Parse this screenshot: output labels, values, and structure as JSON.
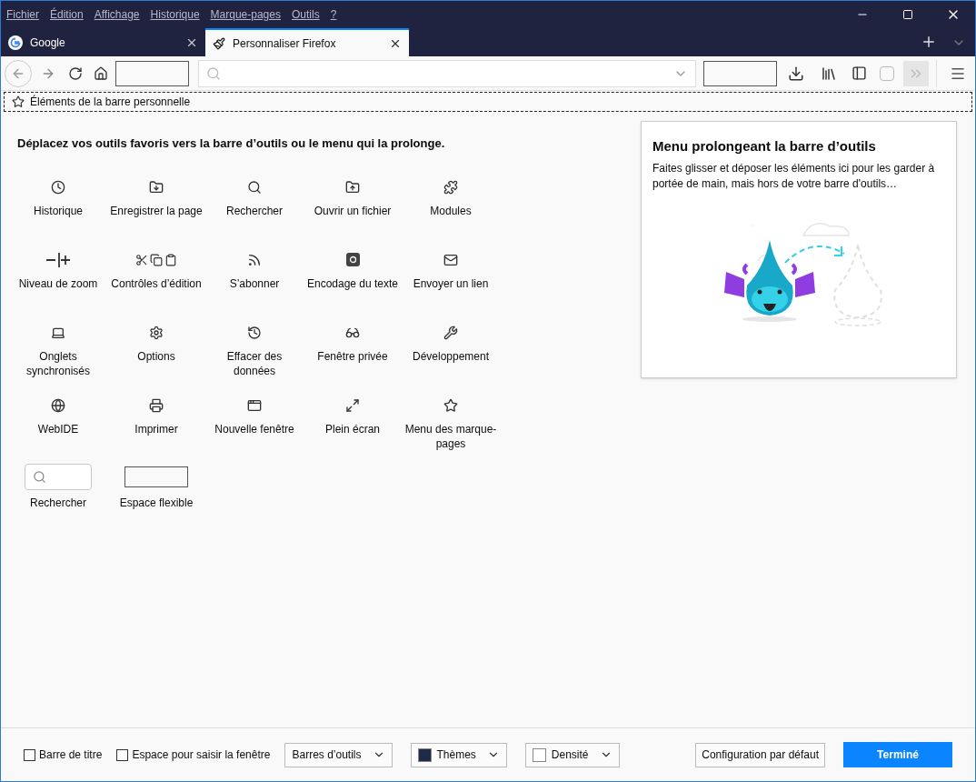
{
  "menu": [
    "Fichier",
    "Édition",
    "Affichage",
    "Historique",
    "Marque-pages",
    "Outils",
    "?"
  ],
  "tabs": [
    {
      "label": "Google",
      "selected": false
    },
    {
      "label": "Personnaliser Firefox",
      "selected": true
    }
  ],
  "bookmarks_bar": {
    "label": "Éléments de la barre personnelle"
  },
  "heading": "Déplacez vos outils favoris vers la barre d’outils ou le menu qui la prolonge.",
  "palette": [
    {
      "kind": "icon",
      "label": "Historique"
    },
    {
      "kind": "icon",
      "label": "Enregistrer la page"
    },
    {
      "kind": "icon",
      "label": "Rechercher"
    },
    {
      "kind": "icon",
      "label": "Ouvrir un fichier"
    },
    {
      "kind": "icon",
      "label": "Modules"
    },
    {
      "kind": "icon",
      "label": "Niveau de zoom"
    },
    {
      "kind": "icon",
      "label": "Contrôles d’édition"
    },
    {
      "kind": "icon",
      "label": "S’abonner"
    },
    {
      "kind": "icon",
      "label": "Encodage du texte"
    },
    {
      "kind": "icon",
      "label": "Envoyer un lien"
    },
    {
      "kind": "icon",
      "label": "Onglets synchronisés"
    },
    {
      "kind": "icon",
      "label": "Options"
    },
    {
      "kind": "icon",
      "label": "Effacer des données"
    },
    {
      "kind": "icon",
      "label": "Fenêtre privée"
    },
    {
      "kind": "icon",
      "label": "Développement"
    },
    {
      "kind": "icon",
      "label": "WebIDE"
    },
    {
      "kind": "icon",
      "label": "Imprimer"
    },
    {
      "kind": "icon",
      "label": "Nouvelle fenêtre"
    },
    {
      "kind": "icon",
      "label": "Plein écran"
    },
    {
      "kind": "icon",
      "label": "Menu des marque-pages"
    },
    {
      "kind": "search",
      "label": "Rechercher"
    },
    {
      "kind": "spacer",
      "label": "Espace flexible"
    }
  ],
  "overflow_panel": {
    "title": "Menu prolongeant la barre d’outils",
    "text": "Faites glisser et déposer les éléments ici pour les garder à portée de main, mais hors de votre barre d'outils…"
  },
  "footer": {
    "checkboxes": [
      {
        "label": "Barre de titre",
        "checked": false
      },
      {
        "label": "Espace pour saisir la fenêtre",
        "checked": false
      }
    ],
    "dropdowns": [
      "Barres d’outils",
      "Thèmes",
      "Densité"
    ],
    "reset_button": "Configuration par défaut",
    "done_button": "Terminé"
  }
}
